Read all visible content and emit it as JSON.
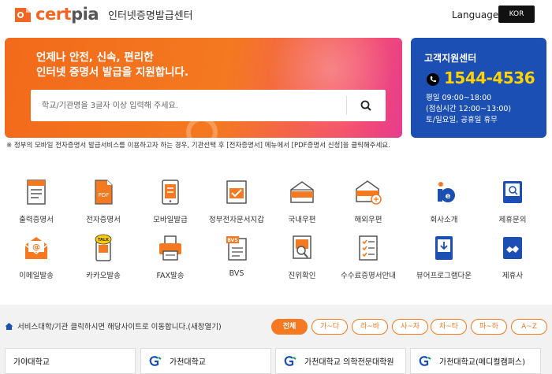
{
  "header": {
    "logo_text_a": "cert",
    "logo_text_b": "pia",
    "subtitle": "인터넷증명발급센터",
    "language_label": "Language",
    "language_value": "KOR"
  },
  "hero": {
    "line1": "언제나 안전, 신속, 편리한",
    "line2": "인터넷 증명서 발급을 지원합니다.",
    "search_placeholder": "학교/기관명을 3글자 이상 입력해 주세요."
  },
  "support": {
    "title": "고객지원센터",
    "phone": "1544-4536",
    "hours1": "평일 09:00~18:00",
    "hours2": "(점심시간 12:00~13:00)",
    "hours3": "토/일요일, 공휴일 휴무"
  },
  "notice": "※ 정부의 모바일 전자증명서 발급서비스를 이용하고자 하는 경우, 기관선택 후 [전자증명서] 메뉴에서 [PDF증명서 신청]을 클릭해주세요.",
  "services": [
    {
      "label": "출력증명서",
      "icon": "printed-certificate-icon"
    },
    {
      "label": "전자증명서",
      "icon": "pdf-certificate-icon"
    },
    {
      "label": "모바일발급",
      "icon": "mobile-issue-icon"
    },
    {
      "label": "정부전자문서지갑",
      "icon": "gov-wallet-icon"
    },
    {
      "label": "국내우편",
      "icon": "domestic-mail-icon"
    },
    {
      "label": "해외우편",
      "icon": "overseas-mail-icon"
    },
    {
      "label": "회사소개",
      "icon": "company-info-icon"
    },
    {
      "label": "제휴문의",
      "icon": "partnership-icon"
    },
    {
      "label": "이메일발송",
      "icon": "email-send-icon"
    },
    {
      "label": "카카오발송",
      "icon": "kakao-send-icon"
    },
    {
      "label": "FAX발송",
      "icon": "fax-send-icon"
    },
    {
      "label": "BVS",
      "icon": "bvs-icon"
    },
    {
      "label": "진위확인",
      "icon": "authenticity-check-icon"
    },
    {
      "label": "수수료증명서안내",
      "icon": "fee-guide-icon"
    },
    {
      "label": "뷰어프로그램다운",
      "icon": "viewer-download-icon"
    },
    {
      "label": "제휴사",
      "icon": "partners-icon"
    }
  ],
  "bottom": {
    "note": "서비스대학/기관 클릭하시면 해당사이트로 이동합니다.(새창열기)",
    "filters": [
      "전체",
      "가~다",
      "라~바",
      "사~자",
      "차~타",
      "파~하",
      "A~Z"
    ],
    "active_filter": "전체",
    "universities": [
      "가야대학교",
      "가천대학교",
      "가천대학교 의학전문대학원",
      "가천대학교(메디컬캠퍼스)"
    ]
  },
  "colors": {
    "accent": "#f47920",
    "support_bg": "#1c4fb3",
    "phone": "#ffd200"
  }
}
